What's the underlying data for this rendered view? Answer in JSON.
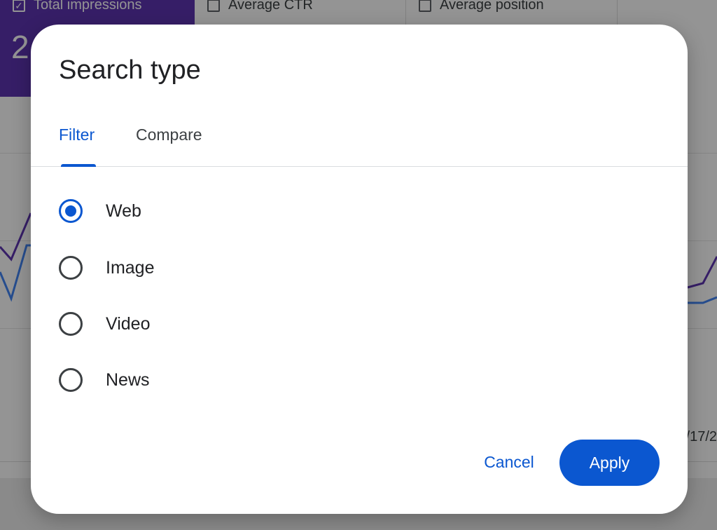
{
  "background": {
    "metrics": [
      {
        "label": "Total impressions",
        "checked": true,
        "value": "2"
      },
      {
        "label": "Average CTR",
        "checked": false
      },
      {
        "label": "Average position",
        "checked": false
      }
    ],
    "x_tick_label": "/17/2"
  },
  "dialog": {
    "title": "Search type",
    "tabs": [
      {
        "label": "Filter",
        "active": true
      },
      {
        "label": "Compare",
        "active": false
      }
    ],
    "options": [
      {
        "label": "Web",
        "selected": true
      },
      {
        "label": "Image",
        "selected": false
      },
      {
        "label": "Video",
        "selected": false
      },
      {
        "label": "News",
        "selected": false
      }
    ],
    "buttons": {
      "cancel": "Cancel",
      "apply": "Apply"
    }
  },
  "colors": {
    "accent": "#0b57d0",
    "impressions_purple": "#5e35b1",
    "clicks_blue": "#4285f4"
  }
}
